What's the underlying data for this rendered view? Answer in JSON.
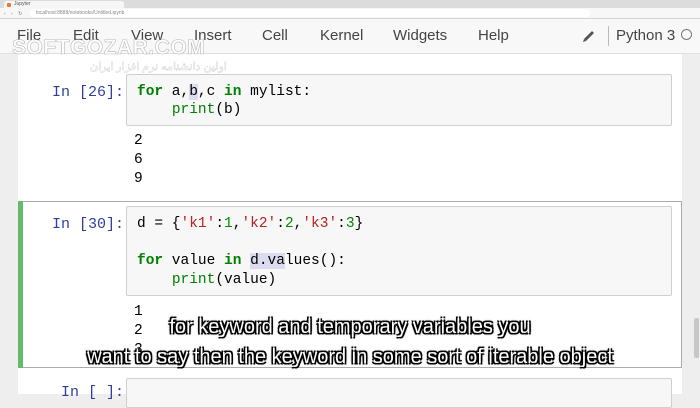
{
  "browser": {
    "tab_title": "Jupyter",
    "url": "localhost:8888/notebooks/Untitled.ipynb"
  },
  "menubar": {
    "items": [
      "File",
      "Edit",
      "View",
      "Insert",
      "Cell",
      "Kernel",
      "Widgets",
      "Help"
    ],
    "kernel": "Python 3"
  },
  "watermark": {
    "brand": "SOFTGOZAR.COM",
    "tagline": "اولین دانشنامه نرم افزار ایران"
  },
  "cells": [
    {
      "prompt": "In [26]:",
      "code": [
        "for a,b,c in mylist:",
        "    print(b)"
      ],
      "outputs": [
        "2",
        "6",
        "9"
      ]
    },
    {
      "prompt": "In [30]:",
      "code": [
        "d = {'k1':1,'k2':2,'k3':3}",
        "",
        "for value in d.values():",
        "    print(value)"
      ],
      "outputs": [
        "1",
        "2",
        "3"
      ]
    },
    {
      "prompt": "In [ ]:"
    }
  ],
  "subtitles": [
    "for keyword and temporary variables you",
    "want to say then the keyword in some sort of iterable object"
  ],
  "colors": {
    "prompt": "#303f9f",
    "keyword": "#008000",
    "string": "#ba2121",
    "selected_cell_bar": "#66bb6a"
  }
}
